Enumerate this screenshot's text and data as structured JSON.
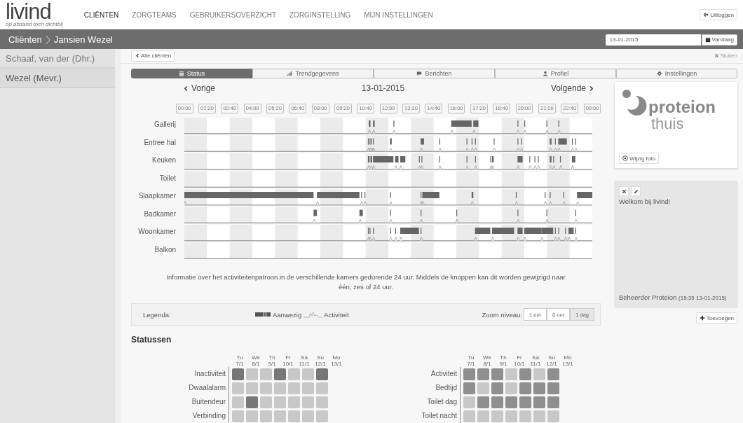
{
  "header": {
    "logo": "livind",
    "tagline": "op afstand toch dichtbij",
    "logout": "Uitloggen",
    "nav": [
      {
        "label": "CLIËNTEN",
        "selected": true
      },
      {
        "label": "ZORGTEAMS",
        "selected": false
      },
      {
        "label": "GEBRUIKERSOVERZICHT",
        "selected": false
      },
      {
        "label": "ZORGINSTELLING",
        "selected": false
      },
      {
        "label": "MIJN INSTELLINGEN",
        "selected": false
      }
    ]
  },
  "breadcrumb": {
    "root": "Cliënten",
    "current": "Jansien Wezel",
    "date": "13-01-2015",
    "today": "Vandaag"
  },
  "sidebar": {
    "items": [
      {
        "label": "Schaaf, van der (Dhr.)",
        "selected": false
      },
      {
        "label": "Wezel (Mevr.)",
        "selected": true
      }
    ]
  },
  "toolbar": {
    "back": "Alle cliënten",
    "close": "Sluiten"
  },
  "tabs": [
    {
      "label": "Status",
      "selected": true
    },
    {
      "label": "Trendgegevens",
      "selected": false
    },
    {
      "label": "Berichten",
      "selected": false
    },
    {
      "label": "Profiel",
      "selected": false
    },
    {
      "label": "Instellingen",
      "selected": false
    }
  ],
  "day_nav": {
    "prev": "Vorige",
    "date": "13-01-2015",
    "next": "Volgende"
  },
  "timeline": {
    "ticks": [
      "00:00",
      "01:20",
      "02:40",
      "04:00",
      "05:20",
      "06:40",
      "08:00",
      "09:20",
      "10:40",
      "12:00",
      "13:20",
      "14:40",
      "16:00",
      "17:20",
      "18:40",
      "20:00",
      "21:20",
      "22:40",
      "00:00"
    ],
    "rooms": [
      "Gallerij",
      "Entree hal",
      "Keuken",
      "Toilet",
      "Slaapkamer",
      "Badkamer",
      "Woonkamer",
      "Balkon"
    ]
  },
  "info": "Informatie over het activiteitenpatroon in de verschillende kamers gedurende 24 uur. Middels de knoppen kan dit worden gewijzigd naar één, zes of 24 uur.",
  "legend": {
    "label": "Legenda:",
    "present": "Aanwezig",
    "activity": "Activiteit",
    "zoom_label": "Zoom niveau:",
    "zoom": [
      {
        "label": "1 uur",
        "selected": false
      },
      {
        "label": "6 uur",
        "selected": false
      },
      {
        "label": "1 dag",
        "selected": true
      }
    ]
  },
  "statuses": {
    "title": "Statussen",
    "grids": [
      {
        "days": [
          {
            "day": "Tu",
            "date": "7/1"
          },
          {
            "day": "We",
            "date": "8/1"
          },
          {
            "day": "Th",
            "date": "9/1"
          },
          {
            "day": "Fr",
            "date": "10/1"
          },
          {
            "day": "Sa",
            "date": "11/1"
          },
          {
            "day": "Su",
            "date": "12/1"
          },
          {
            "day": "Mo",
            "date": "13/1"
          }
        ],
        "rows": [
          {
            "label": "Inactiviteit",
            "cells": [
              {
                "color": "#777777"
              },
              {
                "color": "#c8c8c8"
              },
              {
                "color": "#c8c8c8"
              },
              {
                "color": "#777777"
              },
              {
                "color": "#c8c8c8"
              },
              {
                "color": "#c8c8c8"
              },
              {
                "color": "#777777"
              }
            ]
          },
          {
            "label": "Dwaalalarm",
            "cells": [
              {
                "color": "#c8c8c8"
              },
              {
                "color": "#c8c8c8"
              },
              {
                "color": "#c8c8c8"
              },
              {
                "color": "#c8c8c8"
              },
              {
                "color": "#c8c8c8"
              },
              {
                "color": "#c8c8c8"
              },
              {
                "color": "#c8c8c8"
              }
            ]
          },
          {
            "label": "Buitendeur",
            "cells": [
              {
                "color": "#c8c8c8"
              },
              {
                "color": "#777777"
              },
              {
                "color": "#c8c8c8"
              },
              {
                "color": "#c8c8c8"
              },
              {
                "color": "#c8c8c8"
              },
              {
                "color": "#c8c8c8"
              },
              {
                "color": "#c8c8c8"
              }
            ]
          },
          {
            "label": "Verbinding",
            "cells": [
              {
                "color": "#c8c8c8"
              },
              {
                "color": "#c8c8c8"
              },
              {
                "color": "#c8c8c8"
              },
              {
                "color": "#c8c8c8"
              },
              {
                "color": "#c8c8c8"
              },
              {
                "color": "#c8c8c8"
              },
              {
                "color": "#c8c8c8"
              }
            ]
          }
        ]
      },
      {
        "days": [
          {
            "day": "Tu",
            "date": "7/1"
          },
          {
            "day": "We",
            "date": "8/1"
          },
          {
            "day": "Th",
            "date": "9/1"
          },
          {
            "day": "Fr",
            "date": "10/1"
          },
          {
            "day": "Sa",
            "date": "11/1"
          },
          {
            "day": "Su",
            "date": "12/1"
          },
          {
            "day": "Mo",
            "date": "13/1"
          }
        ],
        "rows": [
          {
            "label": "Activiteit",
            "cells": [
              {
                "color": "#8f8f8f"
              },
              {
                "color": "#8f8f8f"
              },
              {
                "color": "#8f8f8f"
              },
              {
                "color": "#c8c8c8"
              },
              {
                "color": "#8f8f8f"
              },
              {
                "color": "#c8c8c8"
              },
              {
                "color": "#8f8f8f"
              }
            ]
          },
          {
            "label": "Bedtijd",
            "cells": [
              {
                "color": "#8f8f8f"
              },
              {
                "color": "#c8c8c8"
              },
              {
                "color": "#8f8f8f"
              },
              {
                "color": "#c8c8c8"
              },
              {
                "color": "#8f8f8f"
              },
              {
                "color": "#8f8f8f"
              },
              {
                "color": "#8f8f8f"
              }
            ]
          },
          {
            "label": "Toilet dag",
            "cells": [
              {
                "color": "#c8c8c8"
              },
              {
                "color": "#8f8f8f"
              },
              {
                "color": "#8f8f8f"
              },
              {
                "color": "#8f8f8f"
              },
              {
                "color": "#8f8f8f"
              },
              {
                "color": "#8f8f8f"
              },
              {
                "color": "#8f8f8f"
              }
            ]
          },
          {
            "label": "Toilet nacht",
            "cells": [
              {
                "color": "#c8c8c8"
              },
              {
                "color": "#c8c8c8"
              },
              {
                "color": "#c8c8c8"
              },
              {
                "color": "#c8c8c8"
              },
              {
                "color": "#c8c8c8"
              },
              {
                "color": "#c8c8c8"
              },
              {
                "color": "#c8c8c8"
              }
            ]
          }
        ]
      }
    ]
  },
  "profile": {
    "brand": "proteion",
    "sub": "thuis",
    "change_photo": "Wijzig foto"
  },
  "note": {
    "text": "Welkom bij livind!",
    "author": "Beheerder Proteion",
    "time": "(15:35 13-01-2015)"
  },
  "add": "Toevoegen"
}
